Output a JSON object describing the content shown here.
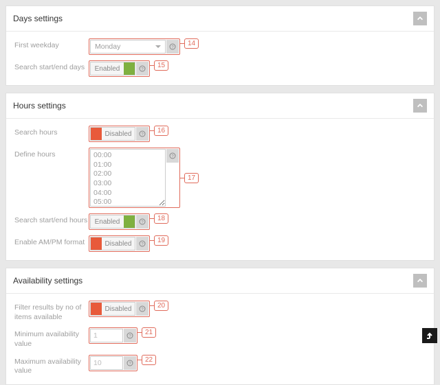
{
  "toggle_labels": {
    "enabled": "Enabled",
    "disabled": "Disabled"
  },
  "days": {
    "title": "Days settings",
    "first_weekday": {
      "label": "First weekday",
      "value": "Monday",
      "callout": "14"
    },
    "search_days": {
      "label": "Search start/end days",
      "state": "enabled",
      "callout": "15"
    }
  },
  "hours": {
    "title": "Hours settings",
    "search_hours": {
      "label": "Search hours",
      "state": "disabled",
      "callout": "16"
    },
    "define_hours": {
      "label": "Define hours",
      "options": [
        "00:00",
        "01:00",
        "02:00",
        "03:00",
        "04:00",
        "05:00"
      ],
      "callout": "17"
    },
    "search_se_hours": {
      "label": "Search start/end hours",
      "state": "enabled",
      "callout": "18"
    },
    "ampm": {
      "label": "Enable AM/PM format",
      "state": "disabled",
      "callout": "19"
    }
  },
  "availability": {
    "title": "Availability settings",
    "filter": {
      "label": "Filter results by no of items available",
      "state": "disabled",
      "callout": "20"
    },
    "min": {
      "label": "Minimum availability value",
      "value": "1",
      "callout": "21"
    },
    "max": {
      "label": "Maximum availability value",
      "value": "10",
      "callout": "22"
    }
  }
}
